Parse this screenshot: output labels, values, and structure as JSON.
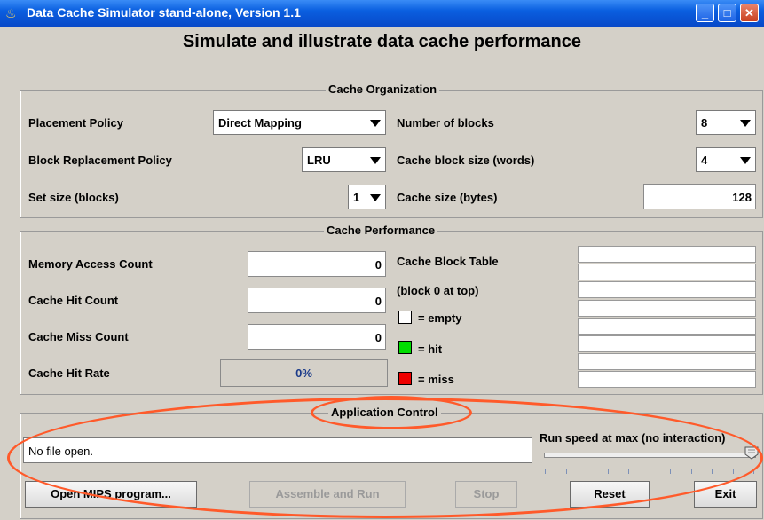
{
  "window": {
    "title": "Data Cache Simulator stand-alone, Version 1.1"
  },
  "heading": "Simulate and illustrate data cache performance",
  "organization": {
    "title": "Cache Organization",
    "placement_label": "Placement Policy",
    "placement_value": "Direct Mapping",
    "replacement_label": "Block Replacement Policy",
    "replacement_value": "LRU",
    "setsize_label": "Set size (blocks)",
    "setsize_value": "1",
    "numblocks_label": "Number of blocks",
    "numblocks_value": "8",
    "blocksize_label": "Cache block size (words)",
    "blocksize_value": "4",
    "cachesize_label": "Cache size (bytes)",
    "cachesize_value": "128"
  },
  "performance": {
    "title": "Cache Performance",
    "access_label": "Memory Access Count",
    "access_value": "0",
    "hit_label": "Cache Hit Count",
    "hit_value": "0",
    "miss_label": "Cache Miss Count",
    "miss_value": "0",
    "rate_label": "Cache Hit Rate",
    "rate_value": "0%",
    "table_label": "Cache Block Table",
    "table_sub": "(block 0 at top)",
    "legend": [
      {
        "label": "= empty",
        "color": "#ffffff"
      },
      {
        "label": "= hit",
        "color": "#00dd00"
      },
      {
        "label": "= miss",
        "color": "#ee0000"
      }
    ]
  },
  "control": {
    "title": "Application Control",
    "status": "No file open.",
    "speed_label": "Run speed at max (no interaction)",
    "speed_fraction": 1.0,
    "buttons": {
      "open": "Open MIPS program...",
      "assemble": "Assemble and Run",
      "stop": "Stop",
      "reset": "Reset",
      "exit": "Exit"
    }
  },
  "colors": {
    "annotation": "#ff5a2a",
    "titlebar": "#0a5fe0"
  }
}
